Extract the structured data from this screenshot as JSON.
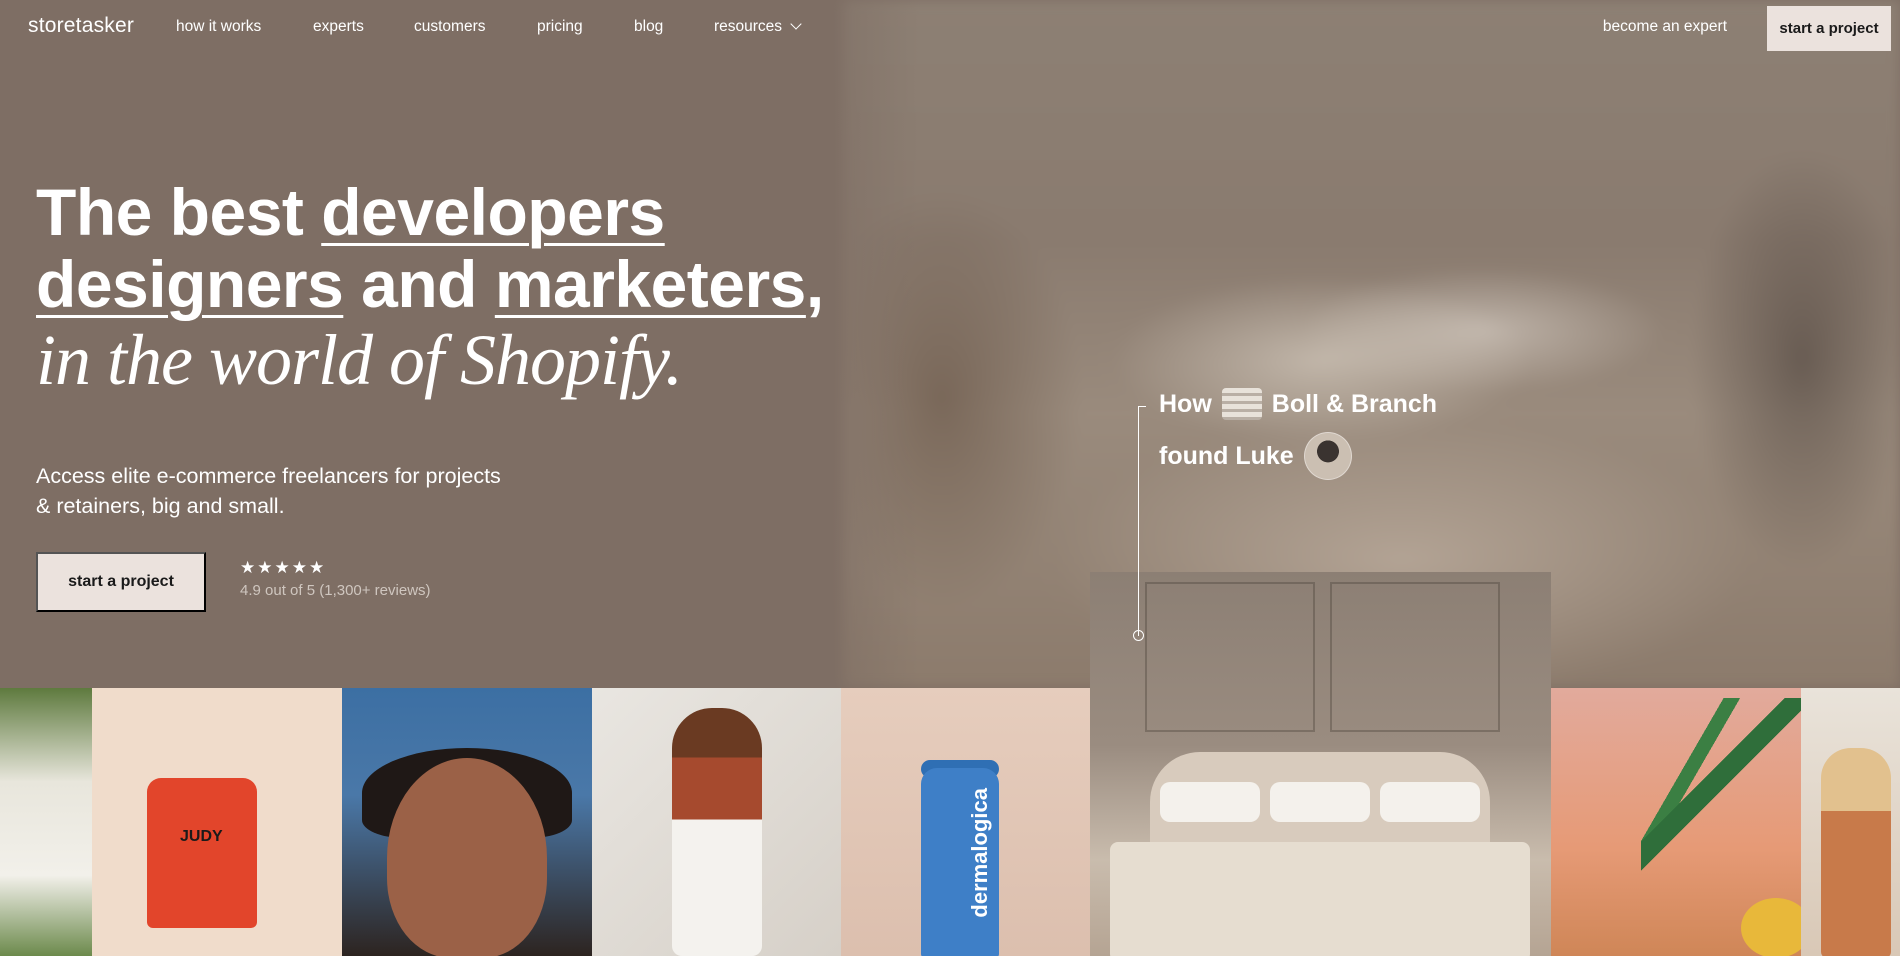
{
  "nav": {
    "logo": "storetasker",
    "links": [
      "how it works",
      "experts",
      "customers",
      "pricing",
      "blog",
      "resources"
    ],
    "become_expert": "become an expert",
    "cta": "start a project"
  },
  "hero": {
    "headline_prefix": "The best ",
    "word_developers": "developers",
    "word_designers": "designers",
    "word_and": " and ",
    "word_marketers": "marketers",
    "comma": ",",
    "italic_line": "in the world of Shopify.",
    "subcopy": "Access elite e-commerce freelancers for projects & retainers, big and small.",
    "cta": "start a project",
    "stars": "★★★★★",
    "rating_text": "4.9 out of 5 (1,300+ reviews)"
  },
  "callout": {
    "how": "How",
    "brand": "Boll & Branch",
    "found": "found Luke"
  },
  "tiles": {
    "judy_label": "JUDY",
    "dermalogica_label": "dermalogica"
  },
  "colors": {
    "hero_bg": "#7e6e64",
    "button_bg": "#ebe2dd",
    "button_text": "#1a1a1a"
  }
}
